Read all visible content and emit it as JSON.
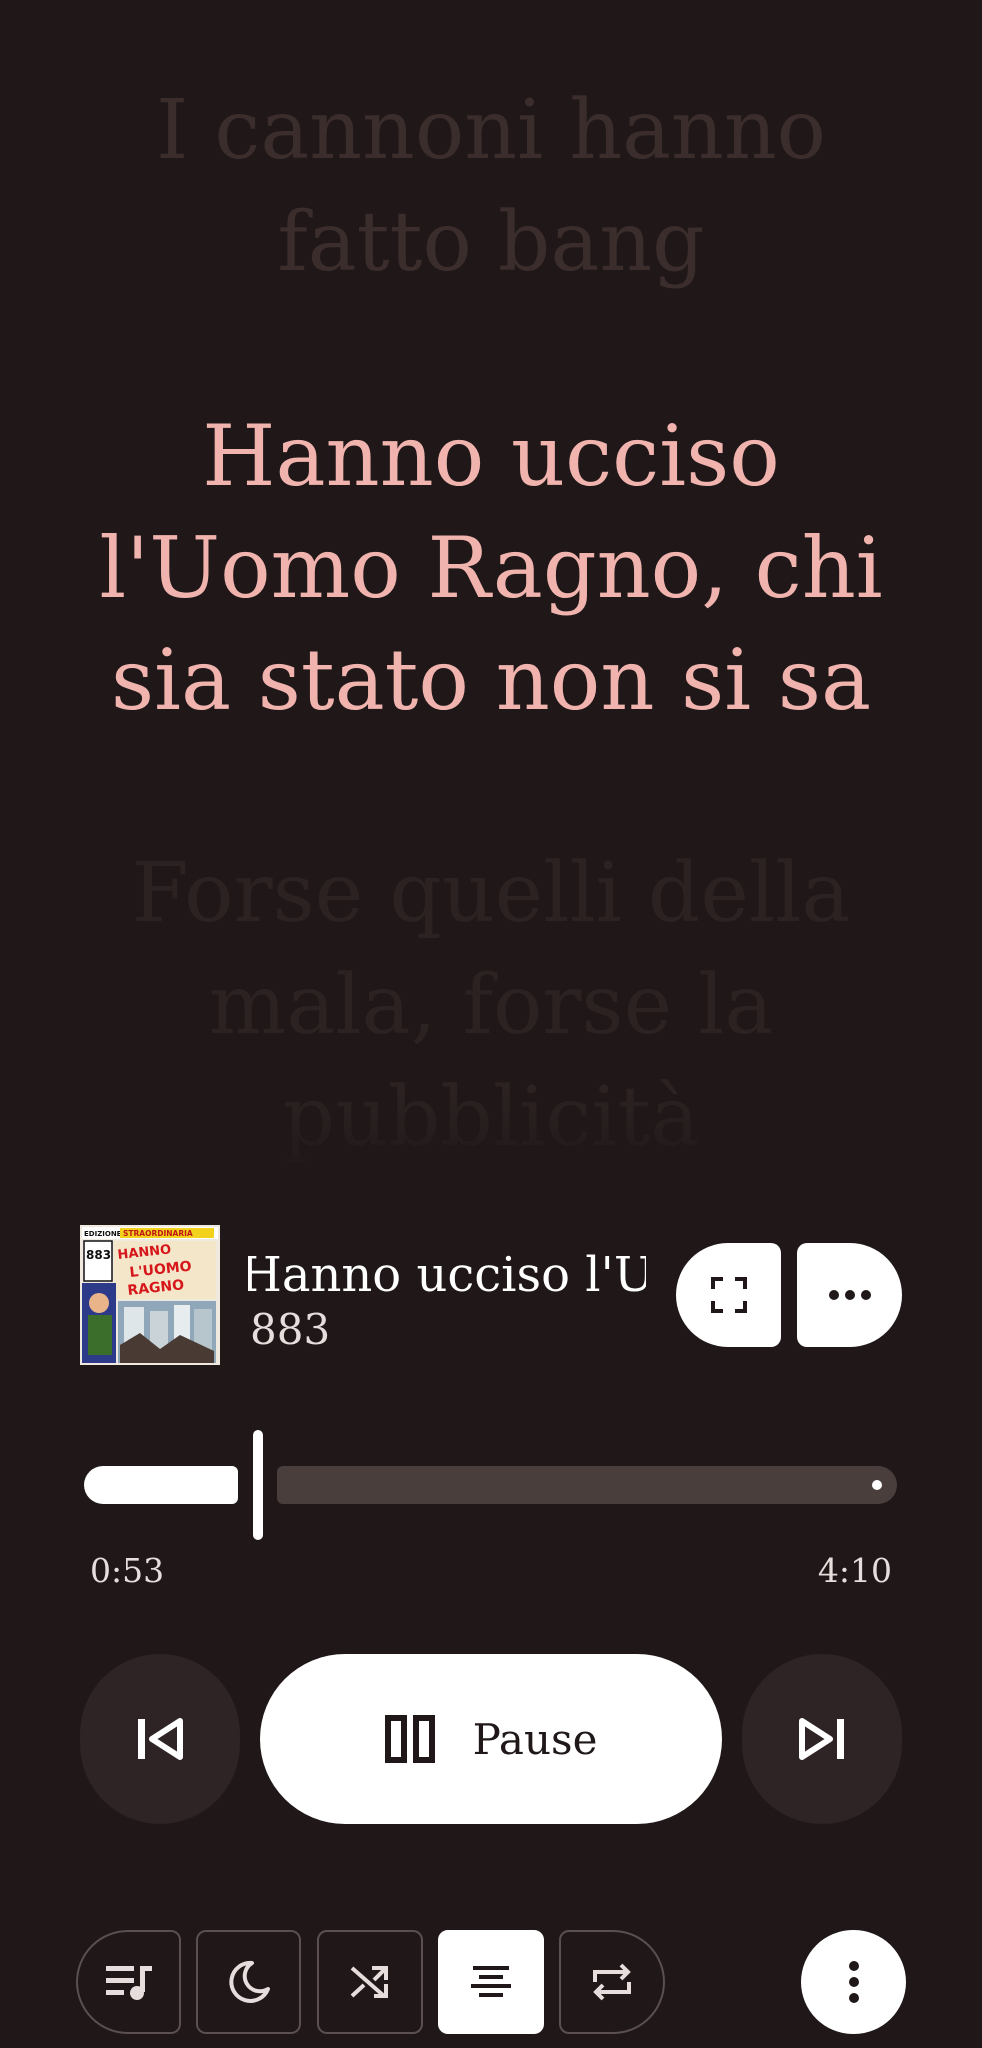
{
  "lyrics": {
    "past": [
      "I cannoni hanno",
      "fatto bang"
    ],
    "current": [
      "Hanno ucciso",
      "l'Uomo Ragno, chi",
      "sia stato non si sa"
    ],
    "next": [
      "Forse quelli della",
      "mala, forse la",
      "pubblicità"
    ]
  },
  "now_playing": {
    "title": "Hanno ucciso l'Uomo Ragno",
    "artist": "883",
    "album_art_text": {
      "banner_left": "EDIZIONE",
      "banner_right": "STRAORDINARIA",
      "logo": "883",
      "headline": "HANNO UCCISO L'UOMO RAGNO"
    }
  },
  "progress": {
    "elapsed": "0:53",
    "total": "4:10",
    "fraction": 0.212
  },
  "controls": {
    "play_label": "Pause",
    "prev_icon": "skip-previous-icon",
    "next_icon": "skip-next-icon",
    "play_icon": "pause-icon"
  },
  "toolbar": {
    "items": [
      "queue-icon",
      "sleep-timer-icon",
      "shuffle-icon",
      "lyrics-icon",
      "repeat-icon"
    ],
    "active": "lyrics-icon"
  },
  "colors": {
    "background": "#1f1718",
    "lyric_current": "#f0b3ad",
    "lyric_dim": "#3a2d2b",
    "surface": "#2e2425",
    "accent": "#ffffff"
  }
}
